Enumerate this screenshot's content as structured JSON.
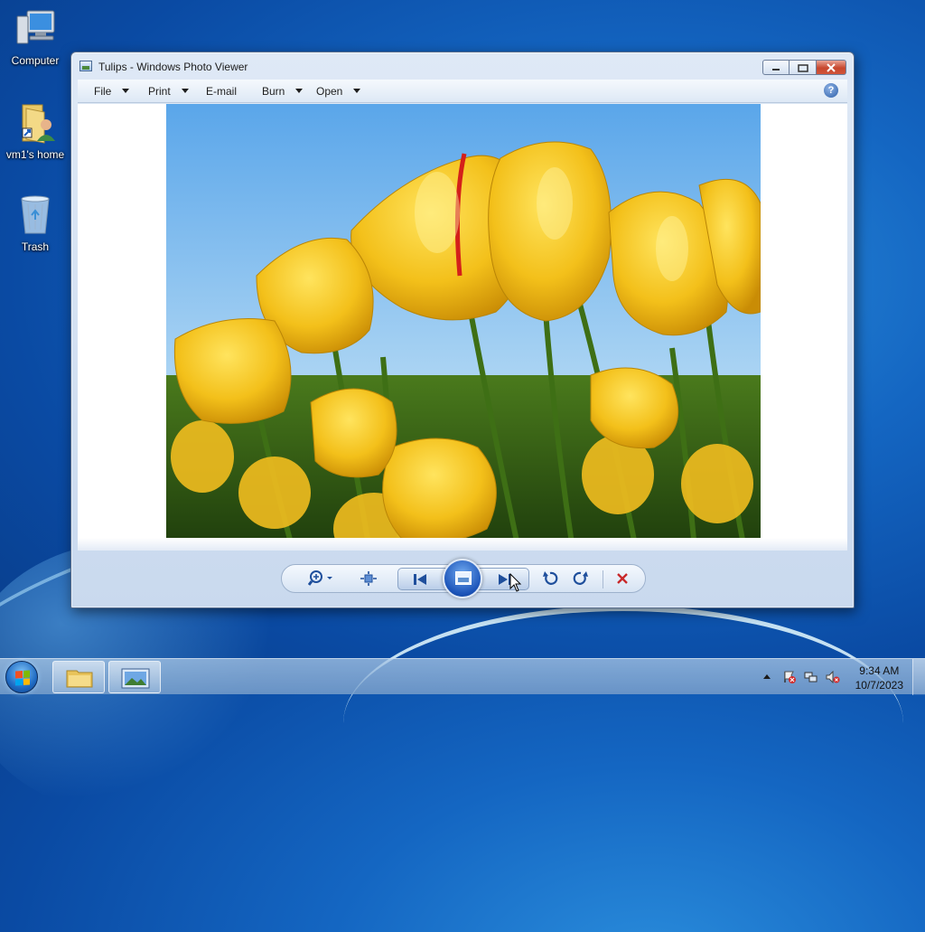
{
  "desktop": {
    "icons": [
      {
        "label": "Computer",
        "icon": "computer-icon"
      },
      {
        "label": "vm1's home",
        "icon": "home-folder-icon"
      },
      {
        "label": "Trash",
        "icon": "recycle-bin-icon"
      }
    ]
  },
  "window": {
    "title": "Tulips - Windows Photo Viewer",
    "menu": [
      {
        "label": "File",
        "has_dropdown": true
      },
      {
        "label": "Print",
        "has_dropdown": true
      },
      {
        "label": "E-mail",
        "has_dropdown": false
      },
      {
        "label": "Burn",
        "has_dropdown": true
      },
      {
        "label": "Open",
        "has_dropdown": true
      }
    ],
    "help_glyph": "?",
    "image_subject": "yellow tulips against blue sky",
    "toolbar_icons": [
      "zoom-icon",
      "actual-size-icon",
      "previous-icon",
      "slideshow-icon",
      "next-icon",
      "rotate-counterclockwise-icon",
      "rotate-clockwise-icon",
      "delete-icon"
    ]
  },
  "taskbar": {
    "time": "9:34 AM",
    "date": "10/7/2023",
    "buttons": [
      "file-explorer-icon",
      "photo-viewer-icon"
    ]
  },
  "colors": {
    "delete_red": "#c8282a",
    "accent_blue": "#1b53b8"
  }
}
